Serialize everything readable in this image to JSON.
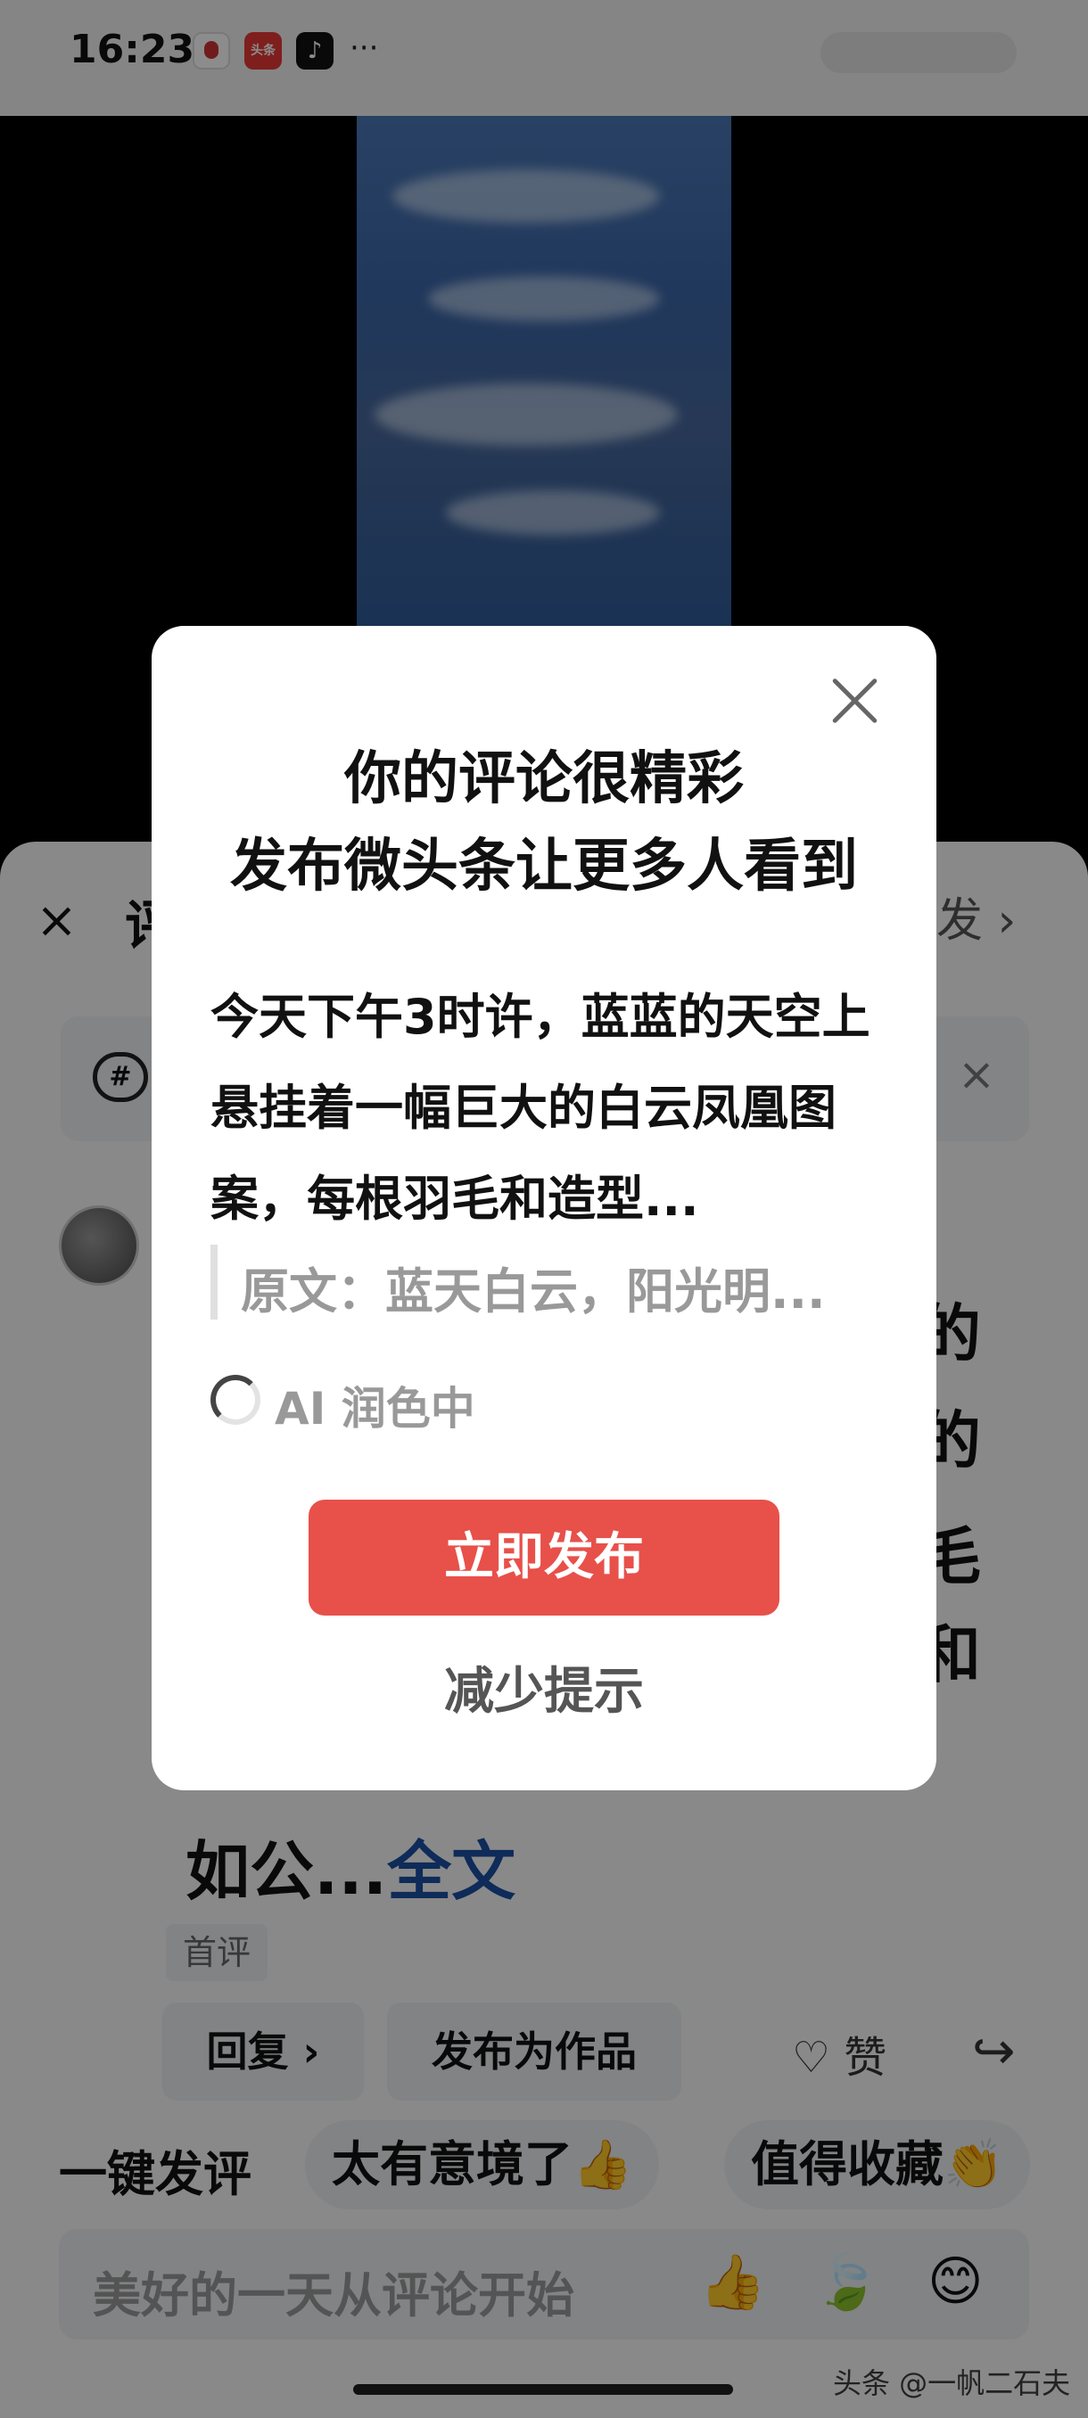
{
  "status_bar": {
    "time": "16:23",
    "toutiao_icon_text": "头条",
    "more": "···"
  },
  "sheet": {
    "title_visible": "评",
    "send_label": "发 ›",
    "close_icon": "×",
    "topic_icon": "#",
    "big_chars": [
      "的",
      "的",
      "毛",
      "和"
    ],
    "comment_tail": "如公...",
    "full_text_link": "全文",
    "first_badge": "首评",
    "reply_button": "回复 ›",
    "publish_work_button": "发布为作品",
    "like_label": "赞",
    "quick_comment_label": "一键发评",
    "quick_chips": [
      "太有意境了👍",
      "值得收藏👏"
    ],
    "input_placeholder": "美好的一天从评论开始",
    "input_emojis": [
      "👍",
      "🍃",
      "😊"
    ]
  },
  "dialog": {
    "title_line1": "你的评论很精彩",
    "title_line2": "发布微头条让更多人看到",
    "body": "今天下午3时许，蓝蓝的天空上悬挂着一幅巨大的白云凤凰图案，每根羽毛和造型...",
    "original_text": "原文：蓝天白云，阳光明...",
    "ai_status": "AI 润色中",
    "publish_button": "立即发布",
    "less_button": "减少提示"
  },
  "watermark": "头条 @一帆二石夫",
  "colors": {
    "primary_red": "#e8504a",
    "link_blue": "#1b4fa3",
    "mask": "rgba(0,0,0,0.45)"
  }
}
